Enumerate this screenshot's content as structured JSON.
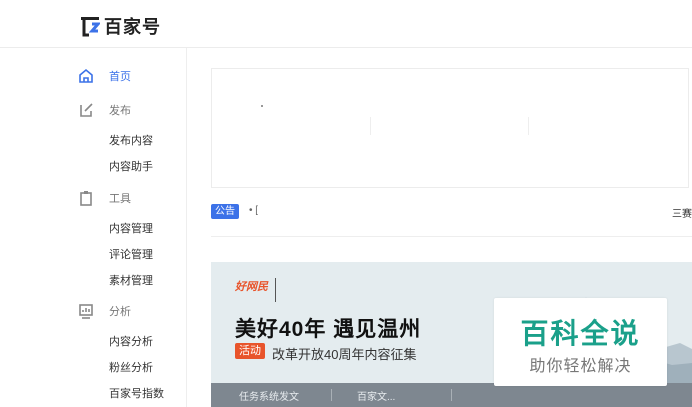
{
  "header": {
    "logo_text": "百家号"
  },
  "sidebar": {
    "home": {
      "label": "首页"
    },
    "publish": {
      "label": "发布",
      "items": [
        "发布内容",
        "内容助手"
      ]
    },
    "tools": {
      "label": "工具",
      "items": [
        "内容管理",
        "评论管理",
        "素材管理"
      ]
    },
    "analysis": {
      "label": "分析",
      "items": [
        "内容分析",
        "粉丝分析",
        "百家号指数"
      ]
    }
  },
  "notice": {
    "badge": "公告",
    "text": "• [",
    "tail": "三赛"
  },
  "banner": {
    "logo_text": "好网民",
    "title": "美好40年 遇见温州",
    "tag": "活动",
    "subtitle": "改革开放40周年内容征集",
    "tabs": [
      "任务系统发文",
      "百家文..."
    ]
  },
  "watermark": {
    "title": "百科全说",
    "subtitle": "助你轻松解决"
  },
  "colors": {
    "accent": "#3c72e8",
    "banner_orange": "#e8542b",
    "watermark_green": "#1aa08a"
  }
}
